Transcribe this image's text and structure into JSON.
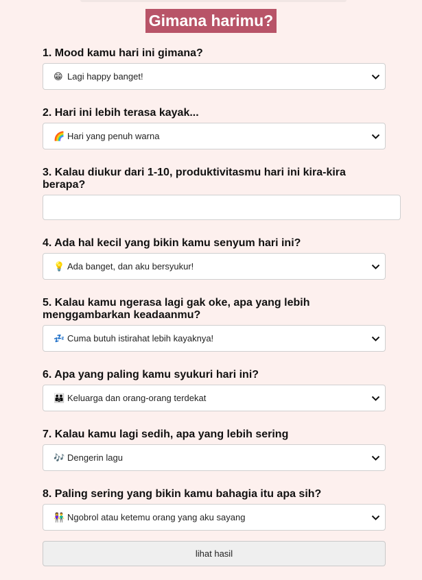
{
  "title": "Gimana harimu?",
  "questions": [
    {
      "label": "1. Mood kamu hari ini gimana?",
      "emoji": "😁",
      "value": "Lagi happy banget!"
    },
    {
      "label": "2. Hari ini lebih terasa kayak...",
      "emoji": "🌈",
      "value": "Hari yang penuh warna"
    },
    {
      "label": "3. Kalau diukur dari 1-10, produktivitasmu hari ini kira-kira berapa?",
      "value": ""
    },
    {
      "label": "4. Ada hal kecil yang bikin kamu senyum hari ini?",
      "emoji": "💡",
      "value": "Ada banget, dan aku bersyukur!"
    },
    {
      "label": "5. Kalau kamu ngerasa lagi gak oke, apa yang lebih menggambarkan keadaanmu?",
      "emoji": "💤",
      "value": "Cuma butuh istirahat lebih kayaknya!"
    },
    {
      "label": "6. Apa yang paling kamu syukuri hari ini?",
      "emoji": "👪",
      "value": "Keluarga dan orang-orang terdekat"
    },
    {
      "label": "7. Kalau kamu lagi sedih, apa yang lebih sering",
      "emoji": "🎶",
      "value": "Dengerin lagu"
    },
    {
      "label": "8. Paling sering yang bikin kamu bahagia itu apa sih?",
      "emoji": "👫",
      "value": "Ngobrol atau ketemu orang yang aku sayang"
    }
  ],
  "submit_label": "lihat hasil",
  "icons": {
    "dropdown": "chevron-down-icon"
  },
  "colors": {
    "title_bg": "#b85468",
    "page_bg": "#fdf0ee"
  }
}
